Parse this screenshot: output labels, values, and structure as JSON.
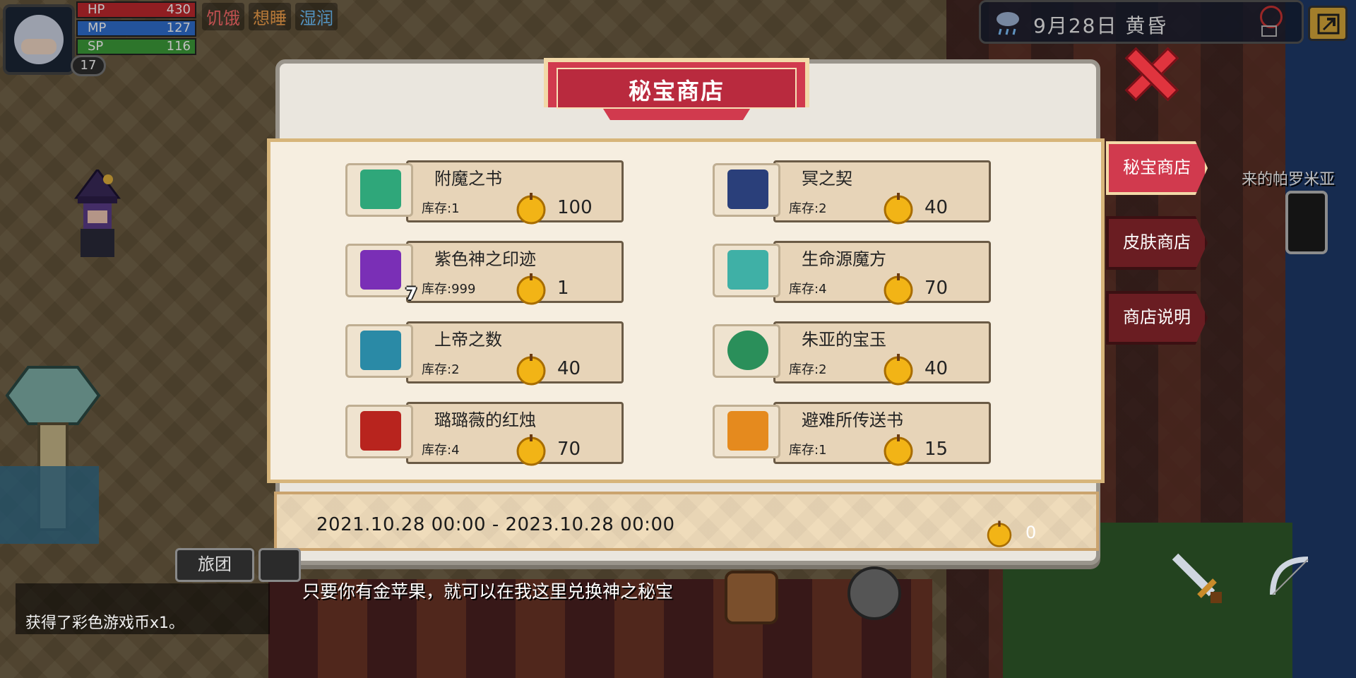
{
  "hud": {
    "hp": {
      "label": "HP",
      "value": "430"
    },
    "mp": {
      "label": "MP",
      "value": "127"
    },
    "sp": {
      "label": "SP",
      "value": "116"
    },
    "level": "17",
    "status": [
      "饥饿",
      "想睡",
      "湿润"
    ],
    "weather": "9月28日  黄昏"
  },
  "shop": {
    "title": "秘宝商店",
    "tabs": [
      "秘宝商店",
      "皮肤商店",
      "商店说明"
    ],
    "items": [
      {
        "name": "附魔之书",
        "stock": "库存:1",
        "price": "100",
        "icon_color": "#2fa77a"
      },
      {
        "name": "冥之契",
        "stock": "库存:2",
        "price": "40",
        "icon_color": "#2a3f7a"
      },
      {
        "name": "紫色神之印迹",
        "stock": "库存:999",
        "price": "1",
        "icon_color": "#7a2fb6"
      },
      {
        "name": "生命源魔方",
        "stock": "库存:4",
        "price": "70",
        "icon_color": "#3fb0a6"
      },
      {
        "name": "上帝之数",
        "stock": "库存:2",
        "price": "40",
        "icon_color": "#2a8aa6"
      },
      {
        "name": "朱亚的宝玉",
        "stock": "库存:2",
        "price": "40",
        "icon_color": "#2a8f5a"
      },
      {
        "name": "璐璐薇的红烛",
        "stock": "库存:4",
        "price": "70",
        "icon_color": "#b8241e"
      },
      {
        "name": "避难所传送书",
        "stock": "库存:1",
        "price": "15",
        "icon_color": "#e58a1e"
      }
    ],
    "qty_badge": "7",
    "date_range": "2021.10.28 00:00 - 2023.10.28 00:00",
    "golden_apples": "0"
  },
  "dialog": {
    "npc_line": "只要你有金苹果，就可以在我这里兑换神之秘宝",
    "chat_line2": "获得了彩色游戏币x1。",
    "team_button": "旅团",
    "npc_name": "来的帕罗米亚"
  }
}
